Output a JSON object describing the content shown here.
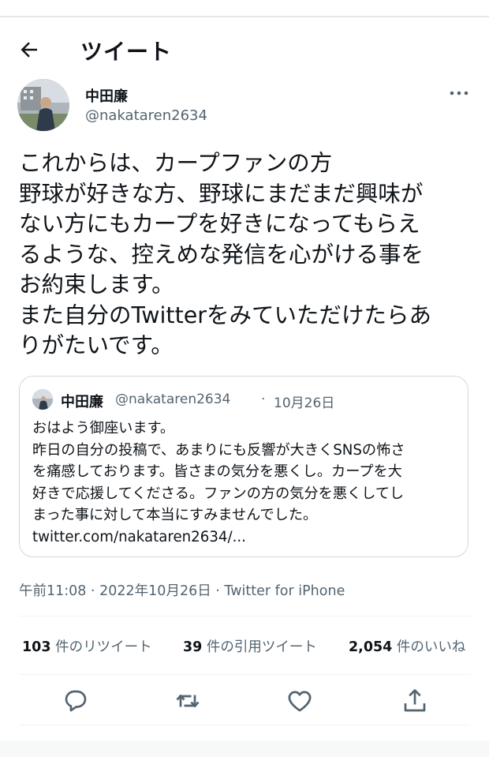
{
  "header": {
    "title": "ツイート"
  },
  "author": {
    "name": "中田廉",
    "handle": "@nakataren2634"
  },
  "tweet": {
    "text": "これからは、カープファンの方\n野球が好きな方、野球にまだまだ興味が\nない方にもカープを好きになってもらえ\nるような、控えめな発信を心がける事を\nお約束します。\nまた自分のTwitterをみていただけたらあ\nりがたいです。"
  },
  "quote": {
    "name": "中田廉",
    "handle": "@nakataren2634",
    "separator": "·",
    "date": "10月26日",
    "body": "おはよう御座います。\n昨日の自分の投稿で、あまりにも反響が大きくSNSの怖さ\nを痛感しております。皆さまの気分を悪くし。カープを大\n好きで応援してくださる。ファンの方の気分を悪くしてし\nまった事に対して本当にすみませんでした。\ntwitter.com/nakataren2634/..."
  },
  "meta": {
    "time": "午前11:08",
    "sep1": " · ",
    "date": "2022年10月26日",
    "sep2": " · ",
    "via": "Twitter for iPhone"
  },
  "stats": {
    "retweets_count": "103",
    "retweets_label": " 件のリツイート",
    "quotes_count": "39",
    "quotes_label": " 件の引用ツイート",
    "likes_count": "2,054",
    "likes_label": " 件のいいね"
  },
  "icons": {
    "back": "arrow-left-icon",
    "more": "more-horizontal-icon",
    "reply": "reply-icon",
    "retweet": "retweet-icon",
    "like": "heart-icon",
    "share": "share-icon"
  },
  "colors": {
    "text": "#0f1419",
    "secondary": "#536471",
    "border": "#cfd9de"
  }
}
